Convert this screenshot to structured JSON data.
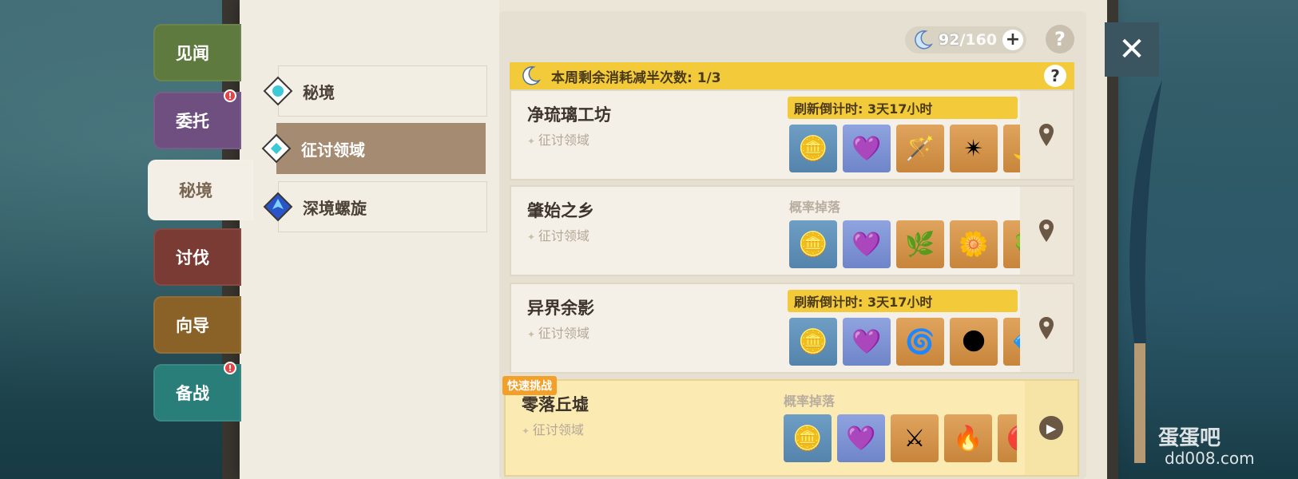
{
  "side_tabs": [
    {
      "label": "见闻",
      "badge": ""
    },
    {
      "label": "委托",
      "badge": "!"
    },
    {
      "label": "秘境",
      "badge": ""
    },
    {
      "label": "讨伐",
      "badge": ""
    },
    {
      "label": "向导",
      "badge": ""
    },
    {
      "label": "备战",
      "badge": "!"
    }
  ],
  "menu": [
    {
      "label": "秘境",
      "active": false
    },
    {
      "label": "征讨领域",
      "active": true
    },
    {
      "label": "深境螺旋",
      "active": false
    }
  ],
  "resin": {
    "current": "92",
    "separator": "/",
    "max": "160",
    "plus": "+"
  },
  "help": "?",
  "close": "✕",
  "banner": {
    "text": "本周剩余消耗减半次数: 1/3",
    "help": "?"
  },
  "domains": [
    {
      "name": "净琉璃工坊",
      "sub": "征讨领域",
      "tag": "",
      "timer": "刷新倒计时: 3天17小时",
      "drop_label": "",
      "rewards": [
        {
          "type": "mora",
          "icon": "mora-coin-icon"
        },
        {
          "type": "exp",
          "icon": "companionship-exp-icon"
        },
        {
          "type": "item",
          "icon": "material-icon"
        },
        {
          "type": "item",
          "icon": "material-icon"
        },
        {
          "type": "item",
          "icon": "material-icon"
        }
      ]
    },
    {
      "name": "肇始之乡",
      "sub": "征讨领域",
      "tag": "",
      "timer": "",
      "drop_label": "概率掉落",
      "rewards": [
        {
          "type": "mora",
          "icon": "mora-coin-icon"
        },
        {
          "type": "exp",
          "icon": "companionship-exp-icon"
        },
        {
          "type": "item",
          "icon": "material-icon"
        },
        {
          "type": "item",
          "icon": "material-icon"
        },
        {
          "type": "item",
          "icon": "material-icon"
        }
      ]
    },
    {
      "name": "异界余影",
      "sub": "征讨领域",
      "tag": "",
      "timer": "刷新倒计时: 3天17小时",
      "drop_label": "",
      "rewards": [
        {
          "type": "mora",
          "icon": "mora-coin-icon"
        },
        {
          "type": "exp",
          "icon": "companionship-exp-icon"
        },
        {
          "type": "item",
          "icon": "material-icon"
        },
        {
          "type": "item",
          "icon": "material-icon"
        },
        {
          "type": "item",
          "icon": "material-icon"
        }
      ]
    },
    {
      "name": "零落丘墟",
      "sub": "征讨领域",
      "tag": "快速挑战",
      "timer": "",
      "drop_label": "概率掉落",
      "rewards": [
        {
          "type": "mora",
          "icon": "mora-coin-icon"
        },
        {
          "type": "exp",
          "icon": "companionship-exp-icon"
        },
        {
          "type": "item",
          "icon": "material-icon"
        },
        {
          "type": "item",
          "icon": "material-icon"
        },
        {
          "type": "item",
          "icon": "material-icon"
        }
      ]
    }
  ],
  "watermark": {
    "brand": "蛋蛋吧",
    "url": "dd008.com"
  },
  "colors": {
    "banner": "#f3cb3a",
    "quick_tag": "#f3a02a",
    "active_menu": "#a68b73"
  }
}
